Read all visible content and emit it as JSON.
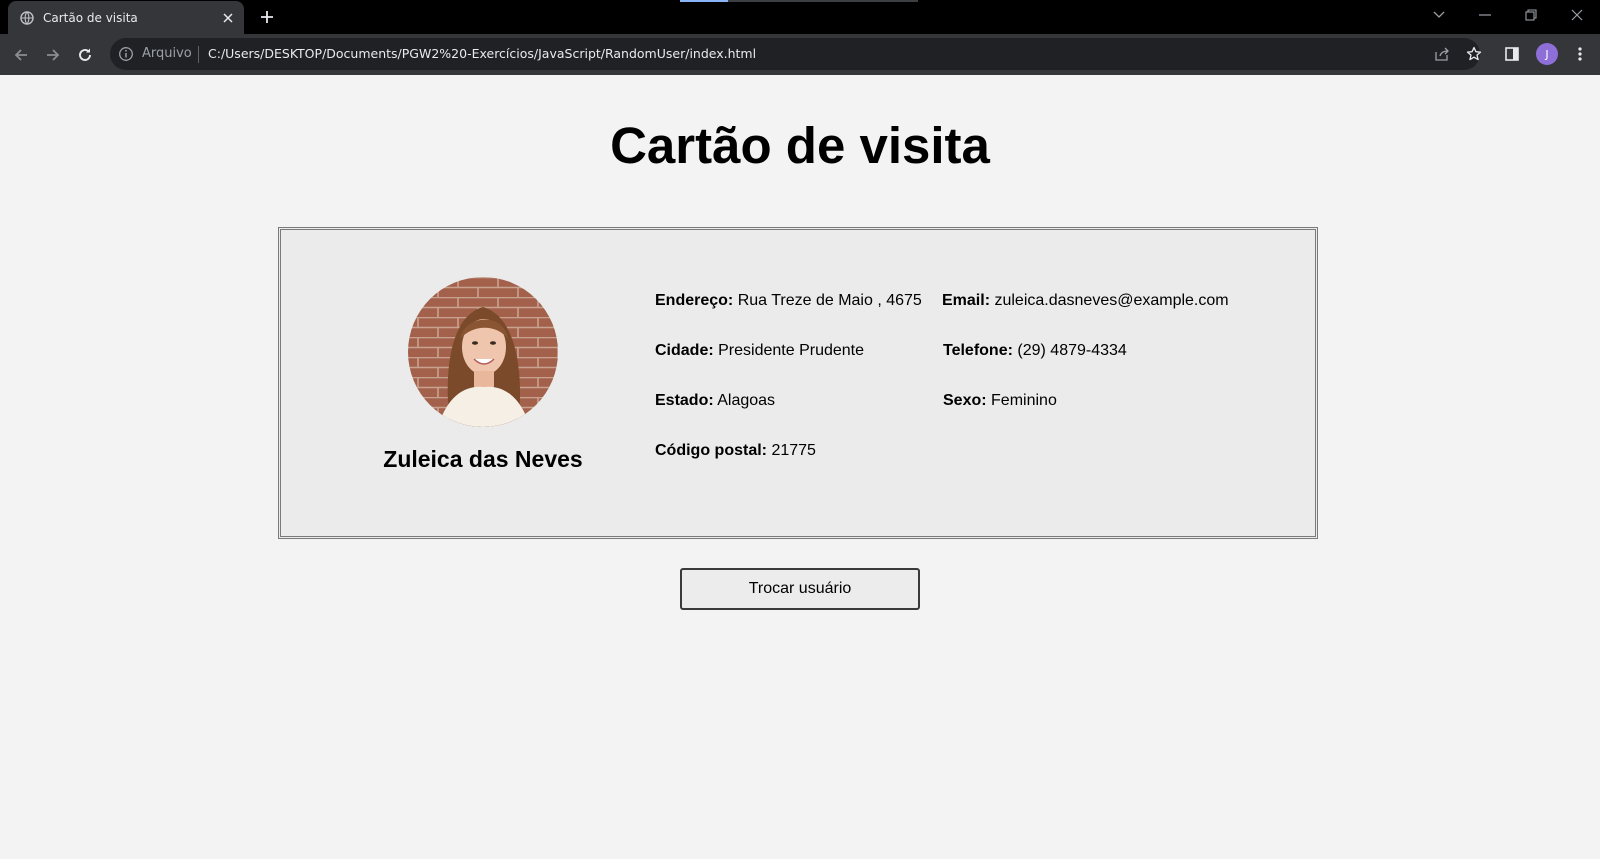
{
  "browser": {
    "tab_title": "Cartão de visita",
    "scheme_label": "Arquivo",
    "url": "C:/Users/DESKTOP/Documents/PGW2%20-Exercícios/JavaScript/RandomUser/index.html",
    "profile_initial": "J",
    "profile_color": "#8e6fd8"
  },
  "page": {
    "title": "Cartão de visita"
  },
  "card": {
    "name": "Zuleica das Neves",
    "photo_alt": "profile-photo",
    "fields_left": [
      {
        "label": "Endereço:",
        "value": "Rua Treze de Maio , 4675"
      },
      {
        "label": "Cidade:",
        "value": "Presidente Prudente"
      },
      {
        "label": "Estado:",
        "value": "Alagoas"
      },
      {
        "label": "Código postal:",
        "value": "21775"
      }
    ],
    "fields_right": [
      {
        "label": "Email:",
        "value": "zuleica.dasneves@example.com"
      },
      {
        "label": "Telefone:",
        "value": "(29) 4879-4334"
      },
      {
        "label": "Sexo:",
        "value": "Feminino"
      }
    ]
  },
  "actions": {
    "switch_user_label": "Trocar usuário"
  },
  "colors": {
    "page_background": "#f3f3f3",
    "card_background": "#ebebeb",
    "chrome_dark": "#35363a"
  }
}
